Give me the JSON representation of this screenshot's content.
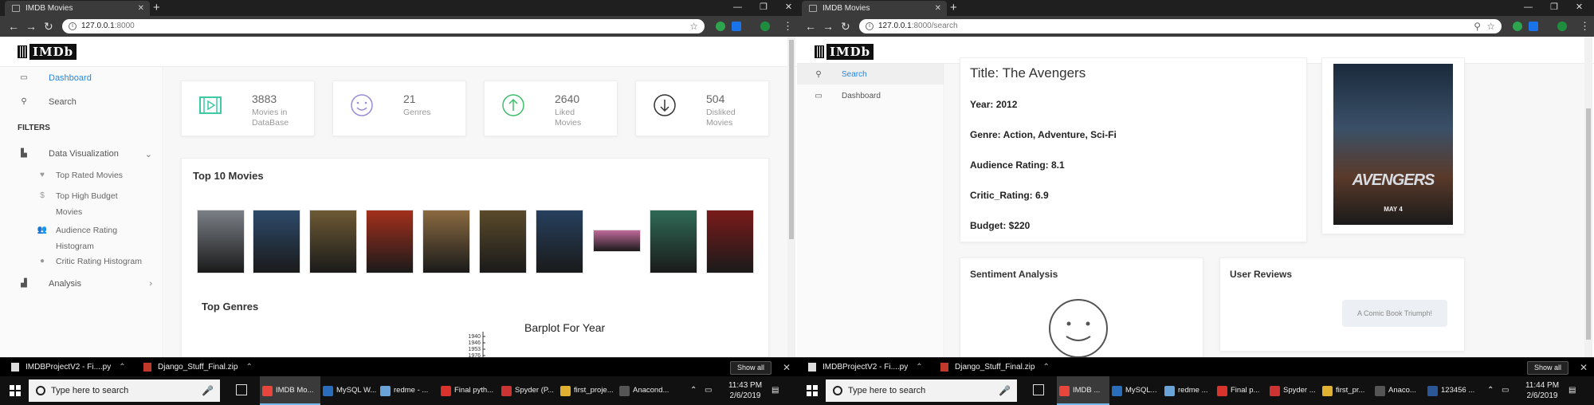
{
  "left": {
    "tab_title": "IMDB Movies",
    "url_host": "127.0.0.1",
    "url_rest": ":8000",
    "logo_text": "IMDb",
    "sidebar": {
      "dashboard": "Dashboard",
      "search": "Search",
      "filters_heading": "FILTERS",
      "data_visualization": "Data Visualization",
      "sub_items": [
        "Top Rated Movies",
        "Top High Budget Movies",
        "Audience Rating Histogram",
        "Critic Rating Histogram"
      ],
      "analysis": "Analysis"
    },
    "stats": [
      {
        "value": "3883",
        "label": "Movies in DataBase",
        "icon": "film-icon",
        "color": "#3ec9a7"
      },
      {
        "value": "21",
        "label": "Genres",
        "icon": "smiley-icon",
        "color": "#9b8bd6"
      },
      {
        "value": "2640",
        "label": "Liked Movies",
        "icon": "arrow-up-circle-icon",
        "color": "#3fbf6a"
      },
      {
        "value": "504",
        "label": "Disliked Movies",
        "icon": "arrow-down-circle-icon",
        "color": "#333333"
      }
    ],
    "top10_title": "Top 10 Movies",
    "posters": [
      "#7a7f86",
      "#2d4a6a",
      "#6e5a34",
      "#a3301c",
      "#8a6a40",
      "#5a4a2a",
      "#26405e",
      "#c06a9a",
      "#2f6a56",
      "#7a1a1a"
    ],
    "top_genres_title": "Top Genres",
    "chart": {
      "chart_data": {
        "type": "bar",
        "title": "Barplot For Year",
        "categories": [
          "1940",
          "1946",
          "1953",
          "1976"
        ],
        "values": []
      }
    },
    "downloads": [
      {
        "name": "IMDBProjectV2 - Fi....py"
      },
      {
        "name": "Django_Stuff_Final.zip"
      }
    ],
    "show_all": "Show all",
    "taskbar": {
      "search_placeholder": "Type here to search",
      "apps": [
        "IMDB Mo...",
        "MySQL W...",
        "redme - ...",
        "Final pyth...",
        "Spyder (P...",
        "first_proje...",
        "Anacond..."
      ],
      "time": "11:43 PM",
      "date": "2/6/2019"
    }
  },
  "right": {
    "tab_title": "IMDB Movies",
    "url_host": "127.0.0.1",
    "url_rest": ":8000/search",
    "logo_text": "IMDb",
    "sidebar": {
      "search": "Search",
      "dashboard": "Dashboard"
    },
    "movie": {
      "title": "Title: The Avengers",
      "year": "Year: 2012",
      "genre": "Genre: Action, Adventure, Sci-Fi",
      "audience": "Audience Rating: 8.1",
      "critic": "Critic_Rating: 6.9",
      "budget": "Budget: $220"
    },
    "poster_text": "AVENGERS",
    "poster_date": "MAY 4",
    "sentiment_title": "Sentiment Analysis",
    "reviews_title": "User Reviews",
    "review_bubble": "A Comic Book Triumph!",
    "downloads": [
      {
        "name": "IMDBProjectV2 - Fi....py"
      },
      {
        "name": "Django_Stuff_Final.zip"
      }
    ],
    "show_all": "Show all",
    "taskbar": {
      "search_placeholder": "Type here to search",
      "apps": [
        "IMDB ...",
        "MySQL...",
        "redme ...",
        "Final p...",
        "Spyder ...",
        "first_pr...",
        "Anaco...",
        "123456 ..."
      ],
      "time": "11:44 PM",
      "date": "2/6/2019"
    }
  }
}
